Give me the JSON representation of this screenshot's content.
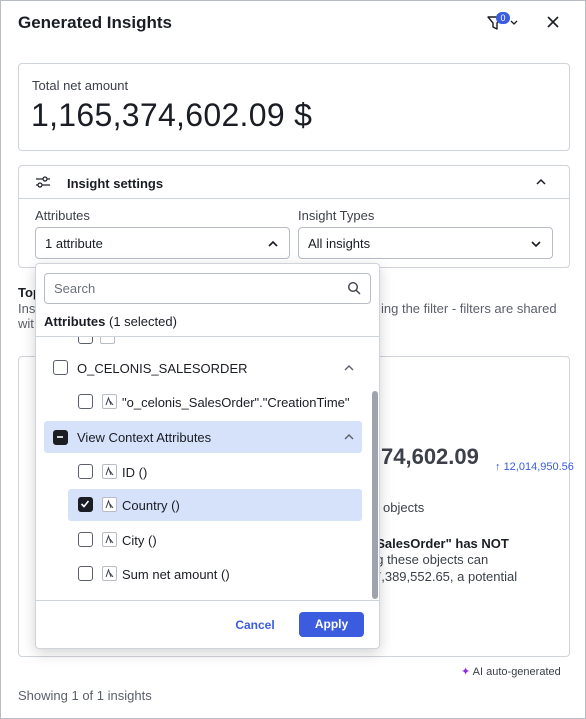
{
  "header": {
    "title": "Generated Insights",
    "filter_count": "0"
  },
  "metric": {
    "label": "Total net amount",
    "value": "1,165,374,602.09 $"
  },
  "settings": {
    "title": "Insight settings",
    "attributes_label": "Attributes",
    "attributes_value": "1 attribute",
    "insight_types_label": "Insight Types",
    "insight_types_value": "All insights"
  },
  "background": {
    "top_prefix": "Top",
    "line1_prefix": "Ins",
    "line1_suffix": "ing the filter - filters are shared",
    "line2_prefix": "wit",
    "card_value_partial": "74,602.09",
    "trend_value": "12,014,950.56",
    "objects_partial": "objects",
    "bold_partial": "eSalesOrder\" has NOT",
    "text_partial_1": "ng these objects can",
    "text_partial_2": "7,389,552.65, a potential"
  },
  "footer": {
    "ai_label": "AI auto-generated",
    "count_text": "Showing 1 of 1 insights"
  },
  "dropdown": {
    "search_placeholder": "Search",
    "header_bold": "Attributes",
    "header_rest": " (1 selected)",
    "groups": [
      {
        "label": "O_CELONIS_SALESORDER",
        "items": [
          {
            "label": "\"o_celonis_SalesOrder\".\"CreationTime\"",
            "checked": false
          }
        ]
      },
      {
        "label": "View Context Attributes",
        "items": [
          {
            "label": "ID ()",
            "checked": false
          },
          {
            "label": "Country ()",
            "checked": true
          },
          {
            "label": "City ()",
            "checked": false
          },
          {
            "label": "Sum net amount ()",
            "checked": false
          }
        ]
      }
    ],
    "cancel_label": "Cancel",
    "apply_label": "Apply"
  },
  "colors": {
    "accent": "#3b5cde",
    "selected_row": "#d6e2fa",
    "ai_star": "#8a2be2"
  }
}
